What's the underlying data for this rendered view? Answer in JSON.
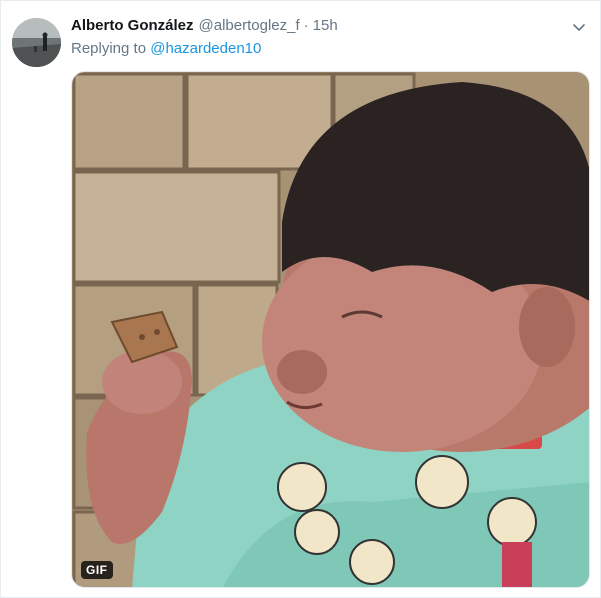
{
  "tweet": {
    "display_name": "Alberto González",
    "handle": "@albertoglez_f",
    "separator": "·",
    "timestamp": "15h",
    "reply_prefix": "Replying to",
    "reply_mention": "@hazardeden10",
    "media_badge": "GIF",
    "media_alt": "GIF of a chubby child eating a cookie",
    "icons": {
      "menu": "chevron-down-icon"
    }
  },
  "colors": {
    "name": "#14171a",
    "secondary": "#657786",
    "link": "#1b95e0",
    "border": "#e6ecf0"
  }
}
